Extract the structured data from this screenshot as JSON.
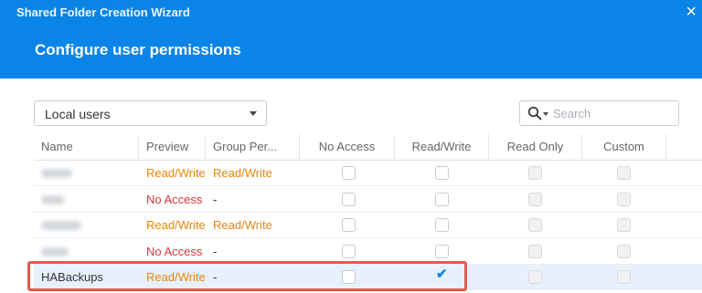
{
  "window": {
    "title": "Shared Folder Creation Wizard",
    "close_label": "×"
  },
  "page": {
    "title": "Configure user permissions"
  },
  "filter": {
    "value": "Local users"
  },
  "search": {
    "placeholder": "Search"
  },
  "columns": [
    "Name",
    "Preview",
    "Group Per...",
    "No Access",
    "Read/Write",
    "Read Only",
    "Custom"
  ],
  "rows": [
    {
      "name": "",
      "name_blurred": true,
      "preview": "Read/Write",
      "group": "Read/Write",
      "no_access": false,
      "read_write": false,
      "read_only": false,
      "custom": false
    },
    {
      "name": "",
      "name_blurred": true,
      "preview": "No Access",
      "group": "-",
      "no_access": false,
      "read_write": false,
      "read_only": false,
      "custom": false
    },
    {
      "name": "",
      "name_blurred": true,
      "preview": "Read/Write",
      "group": "Read/Write",
      "no_access": false,
      "read_write": false,
      "read_only": false,
      "custom": false
    },
    {
      "name": "",
      "name_blurred": true,
      "preview": "No Access",
      "group": "-",
      "no_access": false,
      "read_write": false,
      "read_only": false,
      "custom": false
    },
    {
      "name": "HABackups",
      "name_blurred": false,
      "preview": "Read/Write",
      "group": "-",
      "no_access": false,
      "read_write": true,
      "read_only": false,
      "custom": false,
      "selected": true,
      "highlighted": true
    }
  ],
  "colors": {
    "header_bg": "#0a84e6",
    "read_write": "#e8850c",
    "no_access": "#d33a3a",
    "highlight": "#e8584c",
    "selected_row": "#e7f1fd"
  },
  "icons": {
    "search": "magnifier-icon",
    "close": "close-icon",
    "dropdown": "chevron-down-icon",
    "check": "checkmark-icon"
  }
}
